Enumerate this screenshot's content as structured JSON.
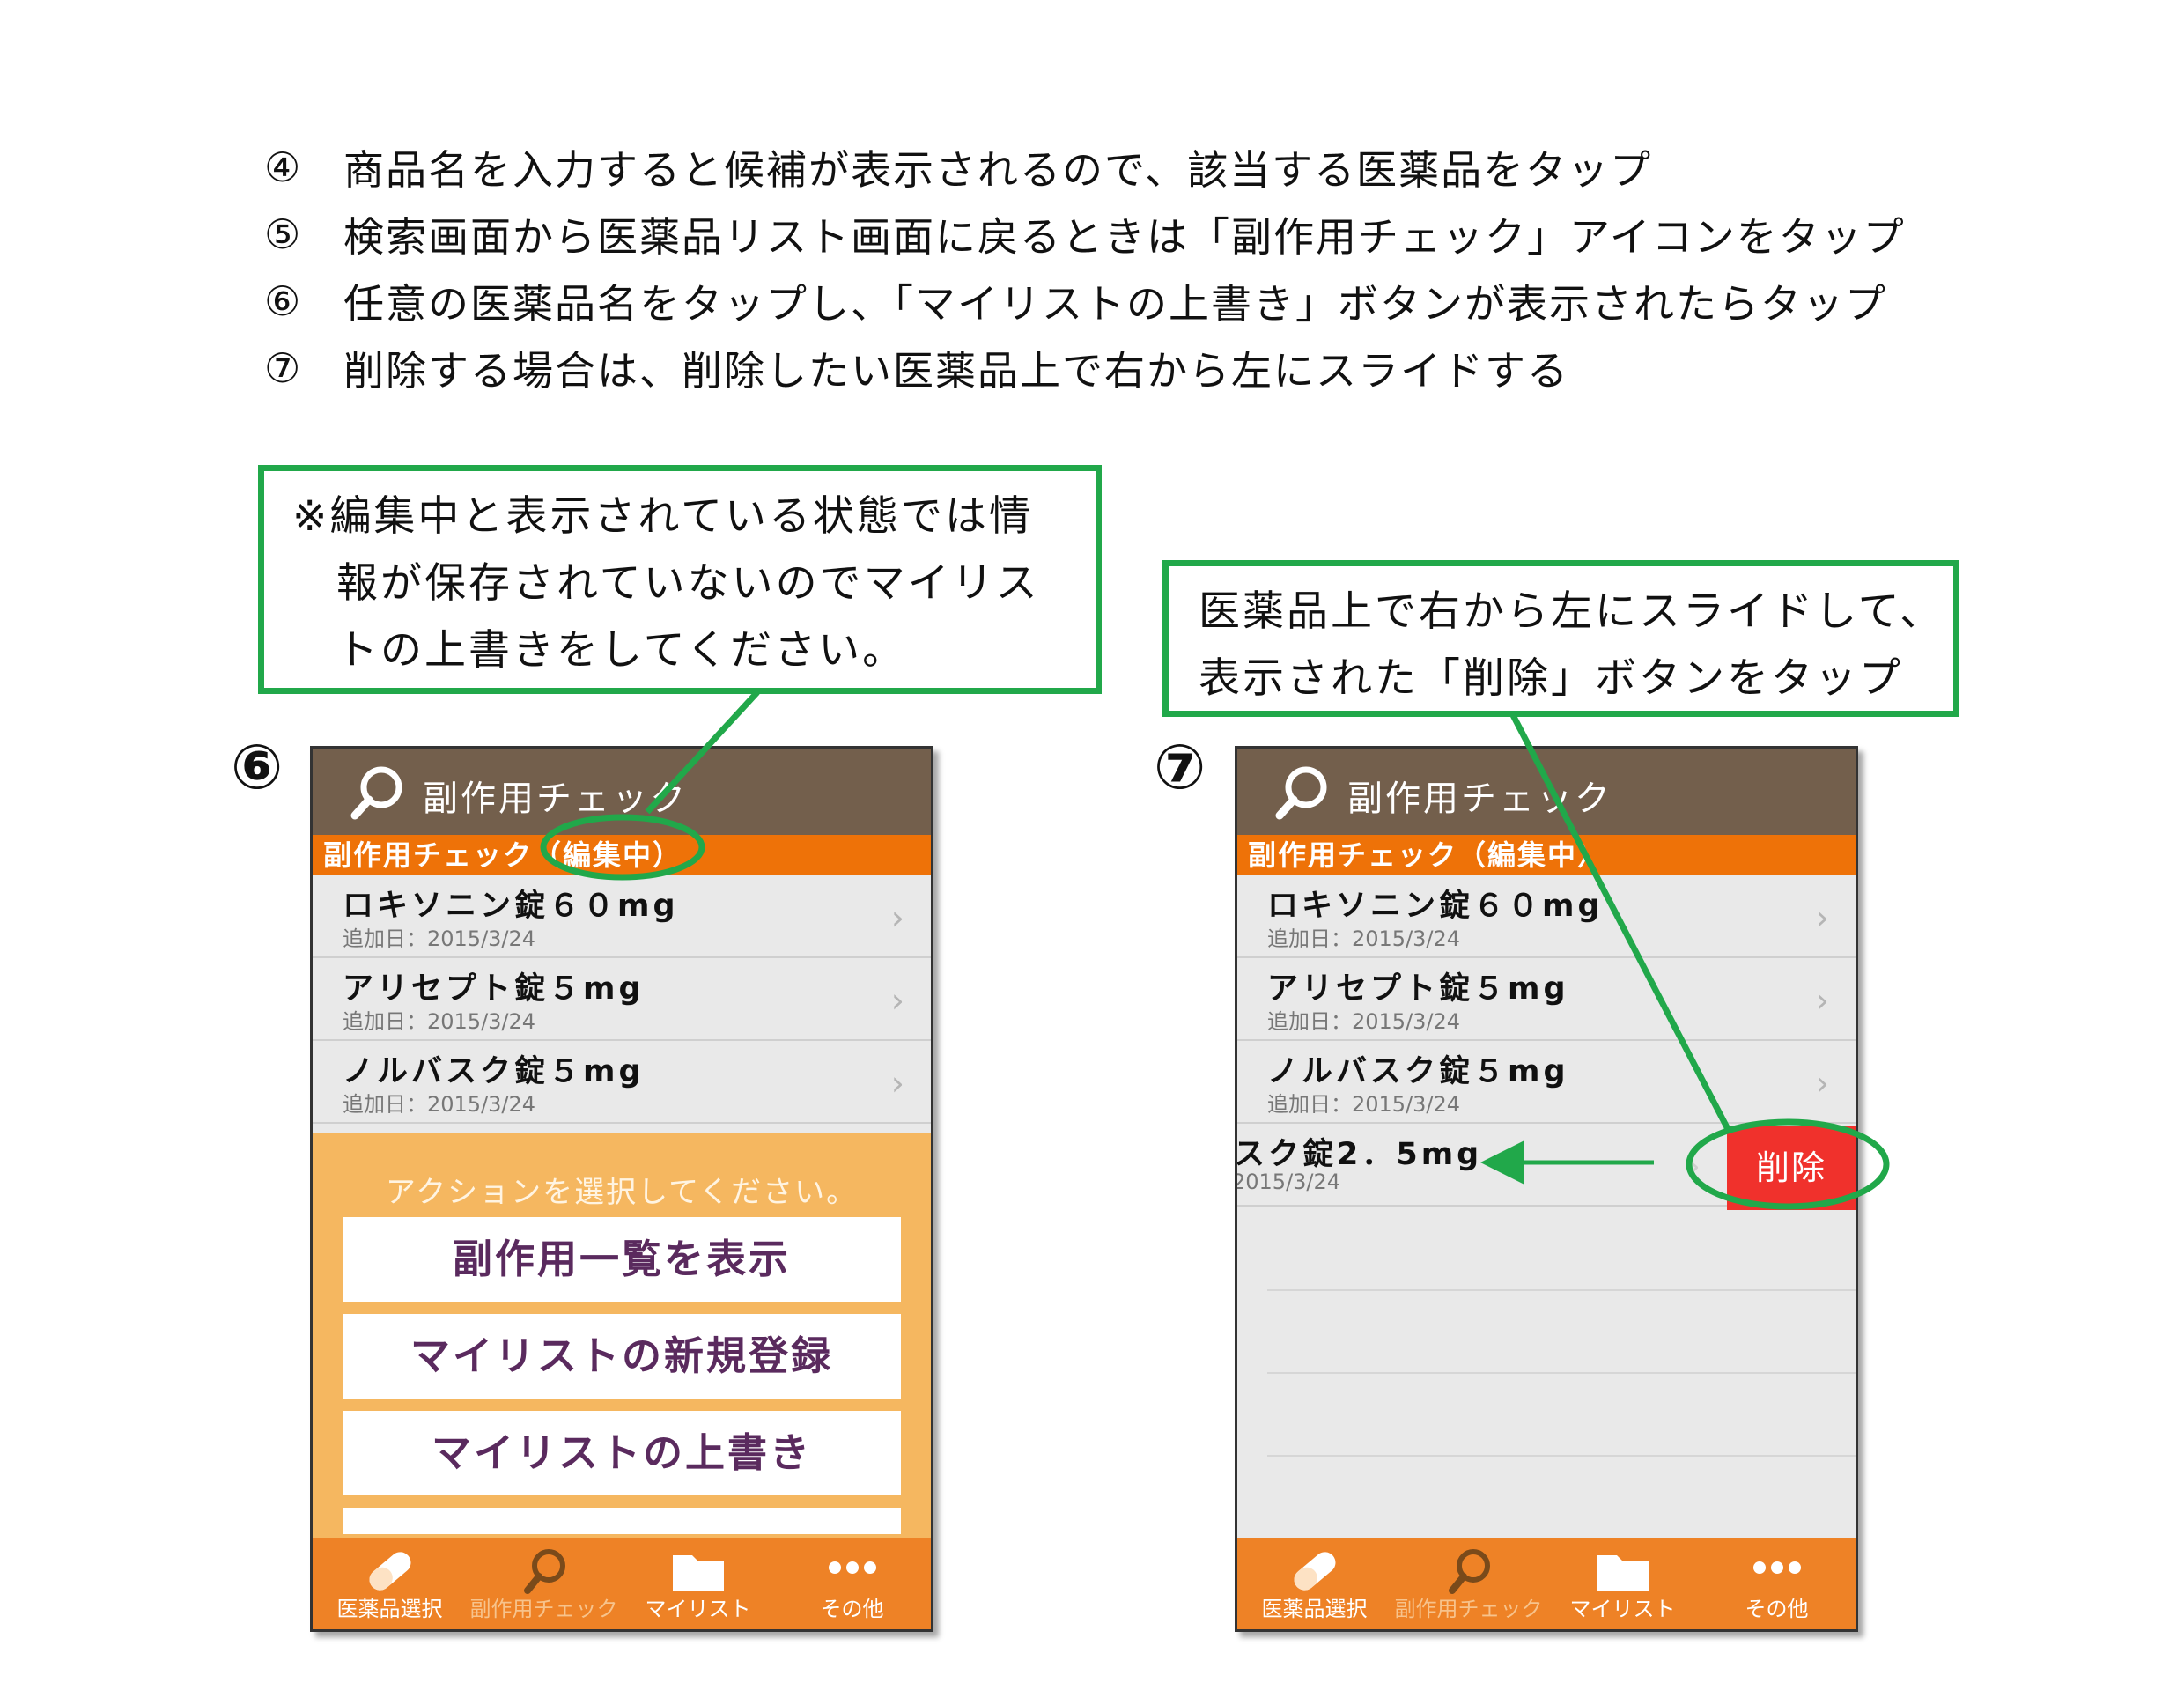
{
  "instructions": [
    {
      "num": "④",
      "text": "商品名を入力すると候補が表示されるので、該当する医薬品をタップ"
    },
    {
      "num": "⑤",
      "text": "検索画面から医薬品リスト画面に戻るときは「副作用チェック」アイコンをタップ"
    },
    {
      "num": "⑥",
      "text": "任意の医薬品名をタップし、「マイリストの上書き」ボタンが表示されたらタップ"
    },
    {
      "num": "⑦",
      "text": "削除する場合は、削除したい医薬品上で右から左にスライドする"
    }
  ],
  "note_left": {
    "line1": "※編集中と表示されている状態では情",
    "line2": "報が保存されていないのでマイリス",
    "line3": "トの上書きをしてください。"
  },
  "note_right": {
    "line1": "医薬品上で右から左にスライドして、",
    "line2": "表示された「削除」ボタンをタップ"
  },
  "markers": {
    "left": "⑥",
    "right": "⑦"
  },
  "app": {
    "header_title": "副作用チェック",
    "sub_header": "副作用チェック（編集中）",
    "items": [
      {
        "name": "ロキソニン錠６０mg",
        "date": "追加日：2015/3/24"
      },
      {
        "name": "アリセプト錠５mg",
        "date": "追加日：2015/3/24"
      },
      {
        "name": "ノルバスク錠５mg",
        "date": "追加日：2015/3/24"
      }
    ],
    "swiped_item": {
      "name": "スク錠2．5mg",
      "date": "2015/3/24"
    },
    "delete_label": "削除",
    "action_prompt": "アクションを選択してください。",
    "actions": [
      "副作用一覧を表示",
      "マイリストの新規登録",
      "マイリストの上書き"
    ],
    "tabs": [
      "医薬品選択",
      "副作用チェック",
      "マイリスト",
      "その他"
    ],
    "active_tab": "副作用チェック"
  },
  "colors": {
    "header": "#735f4c",
    "sub_header": "#ee7208",
    "tab_bar": "#ee8226",
    "action_sheet": "#f5b760",
    "action_text": "#5a2a5e",
    "delete": "#f0312c",
    "annotation": "#21a84a"
  }
}
